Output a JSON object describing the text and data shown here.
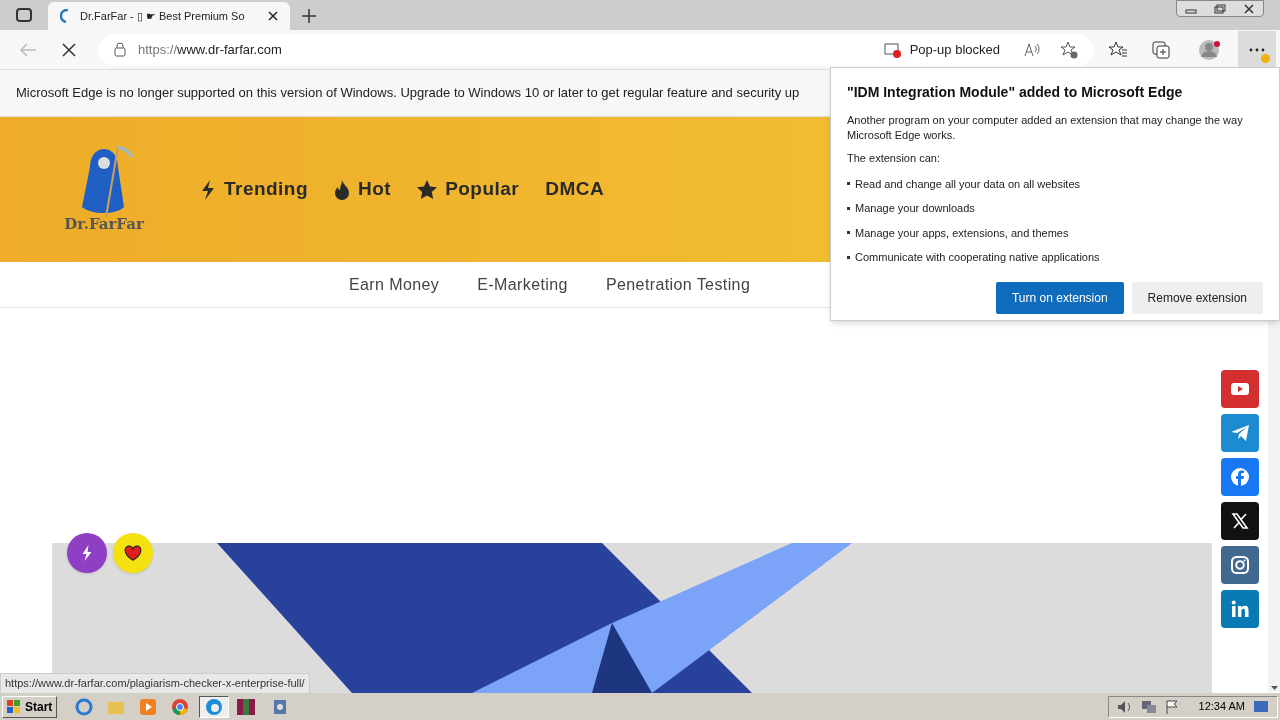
{
  "browser": {
    "tab_title": "Dr.FarFar - ▯ ☛ Best Premium So",
    "url_scheme": "https://",
    "url_host": "www.dr-farfar.com",
    "popup_blocked": "Pop-up blocked"
  },
  "infobar": {
    "text": "Microsoft Edge is no longer supported on this version of Windows. Upgrade to Windows 10 or later to get regular feature and security up"
  },
  "site": {
    "logo_text": "Dr.FarFar",
    "nav": [
      {
        "kind": "bolt",
        "label": "Trending"
      },
      {
        "kind": "fire",
        "label": "Hot"
      },
      {
        "kind": "star",
        "label": "Popular"
      },
      {
        "kind": "none",
        "label": "DMCA"
      }
    ],
    "categories": [
      "Earn Money",
      "E-Marketing",
      "Penetration Testing"
    ],
    "float_buttons": [
      {
        "kind": "bolt",
        "color": "#8e3fc4"
      },
      {
        "kind": "heart",
        "color": "#f5e10f"
      }
    ],
    "social": [
      {
        "kind": "youtube",
        "color": "#d32f2f"
      },
      {
        "kind": "telegram",
        "color": "#1d8bd1"
      },
      {
        "kind": "facebook",
        "color": "#1877f2"
      },
      {
        "kind": "x",
        "color": "#111111"
      },
      {
        "kind": "instagram",
        "color": "#41698f"
      },
      {
        "kind": "linkedin",
        "color": "#0a7ab5"
      }
    ]
  },
  "popup": {
    "title": "\"**IDM Integration Module**\" added to Microsoft Edge",
    "body": "Another program on your computer added an extension that may change the way Microsoft Edge works.",
    "subhead": "The extension can:",
    "bullets": [
      "Read and change all your data on all websites",
      "Manage your downloads",
      "Manage your apps, extensions, and themes",
      "Communicate with cooperating native applications"
    ],
    "buttons": [
      {
        "label": "Turn on extension",
        "primary": true
      },
      {
        "label": "Remove extension",
        "primary": false
      }
    ]
  },
  "status_url": "https://www.dr-farfar.com/plagiarism-checker-x-enterprise-full/",
  "taskbar": {
    "start": "Start",
    "clock": "12:34 AM"
  }
}
